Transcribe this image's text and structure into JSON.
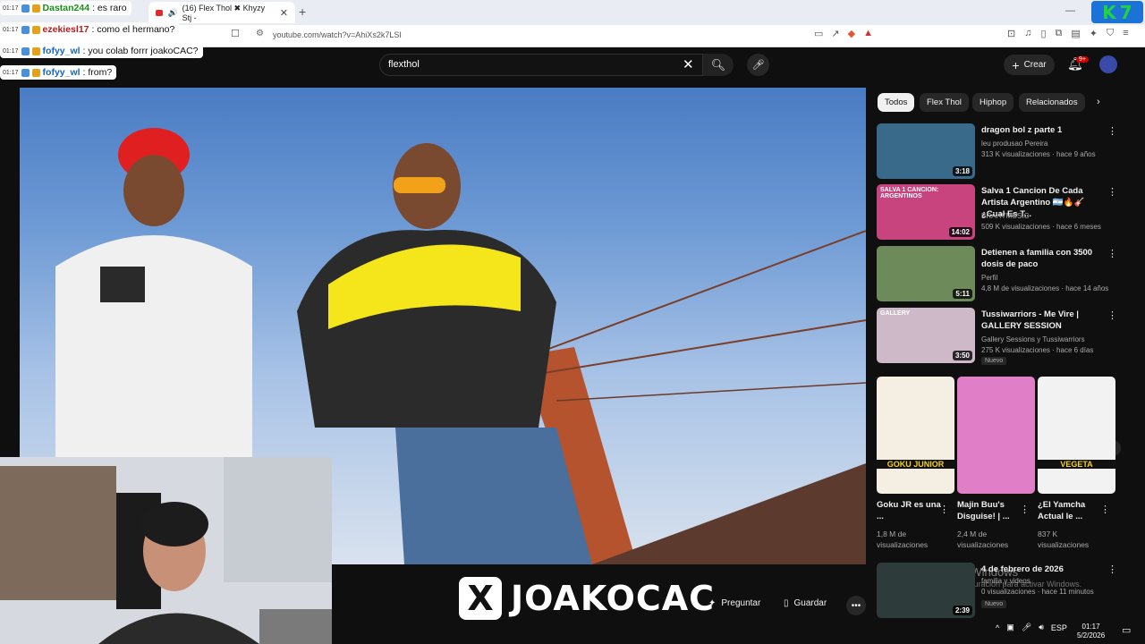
{
  "browser": {
    "tab_title": "(16) Flex Thol ✖ Khyzy Stj -",
    "url": "youtube.com/watch?v=AhiXs2k7LSI"
  },
  "chat": [
    {
      "time": "01:17",
      "user": "Dastan244",
      "user_color": "#1a8f1a",
      "message": ": es raro"
    },
    {
      "time": "01:17",
      "user": "ezekiesl17",
      "user_color": "#b71c1c",
      "message": ": como el hermano?"
    },
    {
      "time": "01:17",
      "user": "fofyy_wl",
      "user_color": "#1565c0",
      "message": ": you colab forrr joakoCAC?"
    },
    {
      "time": "01:17",
      "user": "fofyy_wl",
      "user_color": "#1565c0",
      "message": ": from?"
    }
  ],
  "youtube": {
    "search_value": "flexthol",
    "create_label": "Crear",
    "notification_count": "9+",
    "ask_label": "Preguntar",
    "save_label": "Guardar",
    "chips": [
      "Todos",
      "Flex Thol",
      "Hiphop",
      "Relacionados"
    ],
    "sidebar_videos": [
      {
        "title": "dragon bol z parte 1",
        "channel": "leu produsao Pereira",
        "meta": "313 K visualizaciones · hace 9 años",
        "duration": "3:18",
        "badge": ""
      },
      {
        "title": "Salva 1 Cancion De Cada Artista Argentino 🇦🇷🔥🎸 ¿Cual Es T...",
        "channel": "BRAHYMUSIC",
        "meta": "509 K visualizaciones · hace 6 meses",
        "duration": "14:02",
        "badge": "",
        "thumb_text": "SALVA 1 CANCION: ARGENTINOS"
      },
      {
        "title": "Detienen a familia con 3500 dosis de paco",
        "channel": "Perfil",
        "meta": "4,8 M de visualizaciones · hace 14 años",
        "duration": "5:11",
        "badge": ""
      },
      {
        "title": "Tussiwarriors - Me Vire | GALLERY SESSION",
        "channel": "Gallery Sessions y Tussiwarriors",
        "meta": "275 K visualizaciones · hace 6 días",
        "duration": "3:50",
        "badge": "Nuevo",
        "thumb_text": "GALLERY"
      }
    ],
    "shorts": [
      {
        "title": "Goku JR es una ...",
        "views": "1,8 M de visualizaciones",
        "thumb_text": "GOKU JUNIOR"
      },
      {
        "title": "Majin Buu's Disguise! | ...",
        "views": "2,4 M de visualizaciones",
        "thumb_text": ""
      },
      {
        "title": "¿El Yamcha Actual le ...",
        "views": "837 K visualizaciones",
        "thumb_text": "VEGETA"
      }
    ],
    "last_video": {
      "title": "4 de febrero de 2026",
      "channel": "familia y videos",
      "meta": "0 visualizaciones · hace 11 minutos",
      "duration": "2:39",
      "badge": "Nuevo"
    }
  },
  "overlay_brand": "JOAKOCAC",
  "watermark": {
    "line1": "Activar Windows",
    "line2": "Ve a Configuración para activar Windows."
  },
  "taskbar": {
    "lang": "ESP",
    "time": "01:17",
    "date": "5/2/2026"
  },
  "colors": {
    "youtube_red": "#ff0000",
    "logo_blue": "#1b73d8",
    "logo_green": "#22d340"
  }
}
